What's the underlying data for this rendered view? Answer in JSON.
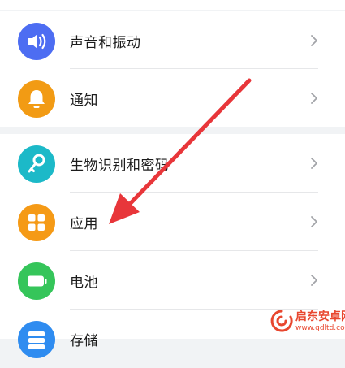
{
  "settings": {
    "items": [
      {
        "id": "sound",
        "label": "声音和振动",
        "icon": "speaker-icon",
        "color": "#4d6df2"
      },
      {
        "id": "notifications",
        "label": "通知",
        "icon": "bell-icon",
        "color": "#f29b14"
      },
      {
        "id": "biometrics",
        "label": "生物识别和密码",
        "icon": "key-icon",
        "color": "#1cb9c8"
      },
      {
        "id": "apps",
        "label": "应用",
        "icon": "apps-grid-icon",
        "color": "#f59a16"
      },
      {
        "id": "battery",
        "label": "电池",
        "icon": "battery-icon",
        "color": "#35c55a"
      },
      {
        "id": "storage",
        "label": "存储",
        "icon": "storage-icon",
        "color": "#2f8cf0"
      }
    ],
    "chevron_icon": "chevron-right-icon"
  },
  "annotation": {
    "arrow_color": "#e8363a",
    "arrow_icon": "red-arrow-icon"
  },
  "watermark": {
    "brand": "启东安卓网",
    "url": "www.qdltd.com",
    "logo_icon": "watermark-logo-icon",
    "color": "#e8472f"
  }
}
